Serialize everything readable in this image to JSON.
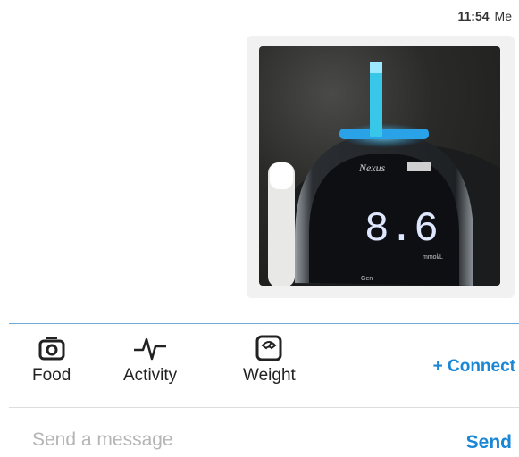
{
  "message": {
    "time": "11:54",
    "sender": "Me",
    "photo": {
      "brand_text": "Nexus",
      "reading": "8.6",
      "unit": "mmol/L",
      "sub_label": "Gen",
      "strip_color": "#38c7e8"
    }
  },
  "toolbar": {
    "items": [
      {
        "label": "Food",
        "icon": "camera-icon"
      },
      {
        "label": "Activity",
        "icon": "pulse-icon"
      },
      {
        "label": "Weight",
        "icon": "scale-icon"
      }
    ],
    "connect_label": "+ Connect"
  },
  "composer": {
    "placeholder": "Send a message",
    "value": "",
    "send_label": "Send"
  },
  "colors": {
    "accent": "#1a86d6",
    "divider": "#6fa9d8"
  }
}
